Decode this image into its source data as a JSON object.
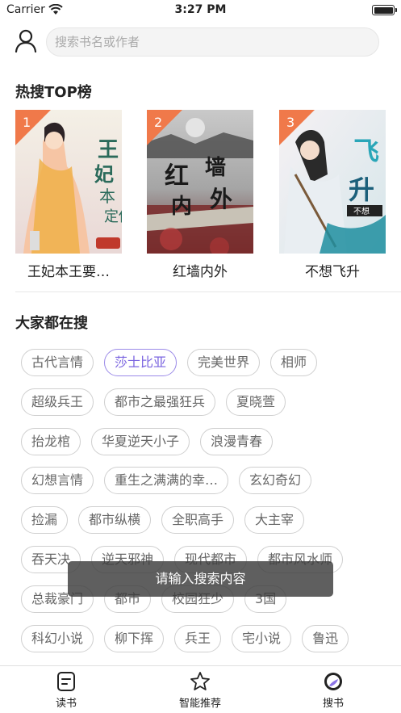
{
  "status_bar": {
    "carrier": "Carrier",
    "time": "3:27 PM"
  },
  "search": {
    "placeholder": "搜索书名或作者",
    "value": ""
  },
  "hot_section": {
    "title": "热搜TOP榜"
  },
  "books": [
    {
      "rank": "1",
      "title": "王妃本王要…",
      "cover_text": "王妃本王要定你"
    },
    {
      "rank": "2",
      "title": "红墙内外",
      "cover_text": "红墙内外"
    },
    {
      "rank": "3",
      "title": "不想飞升",
      "cover_text": "不想飞升"
    }
  ],
  "popular_section": {
    "title": "大家都在搜"
  },
  "tag_rows": [
    [
      "古代言情",
      "莎士比亚",
      "完美世界",
      "相师"
    ],
    [
      "超级兵王",
      "都市之最强狂兵",
      "夏晓萱"
    ],
    [
      "抬龙棺",
      "华夏逆天小子",
      "浪漫青春"
    ],
    [
      "幻想言情",
      "重生之满满的幸…",
      "玄幻奇幻"
    ],
    [
      "捡漏",
      "都市纵横",
      "全职高手",
      "大主宰"
    ],
    [
      "吞天决",
      "逆天邪神",
      "现代都市",
      "都市风水师"
    ],
    [
      "总裁豪门",
      "都市",
      "校园狂少",
      "3国"
    ],
    [
      "科幻小说",
      "柳下挥",
      "兵王",
      "宅小说",
      "鲁迅"
    ]
  ],
  "active_tag": "莎士比亚",
  "toast": {
    "message": "请输入搜索内容"
  },
  "tabbar": {
    "tabs": [
      {
        "label": "读书",
        "icon": "book-icon"
      },
      {
        "label": "智能推荐",
        "icon": "star-icon"
      },
      {
        "label": "搜书",
        "icon": "search-icon"
      }
    ]
  },
  "colors": {
    "rank_badge": "#f0794a",
    "active_tag": "#7a64e0",
    "toast_bg": "#3c3c3c"
  }
}
